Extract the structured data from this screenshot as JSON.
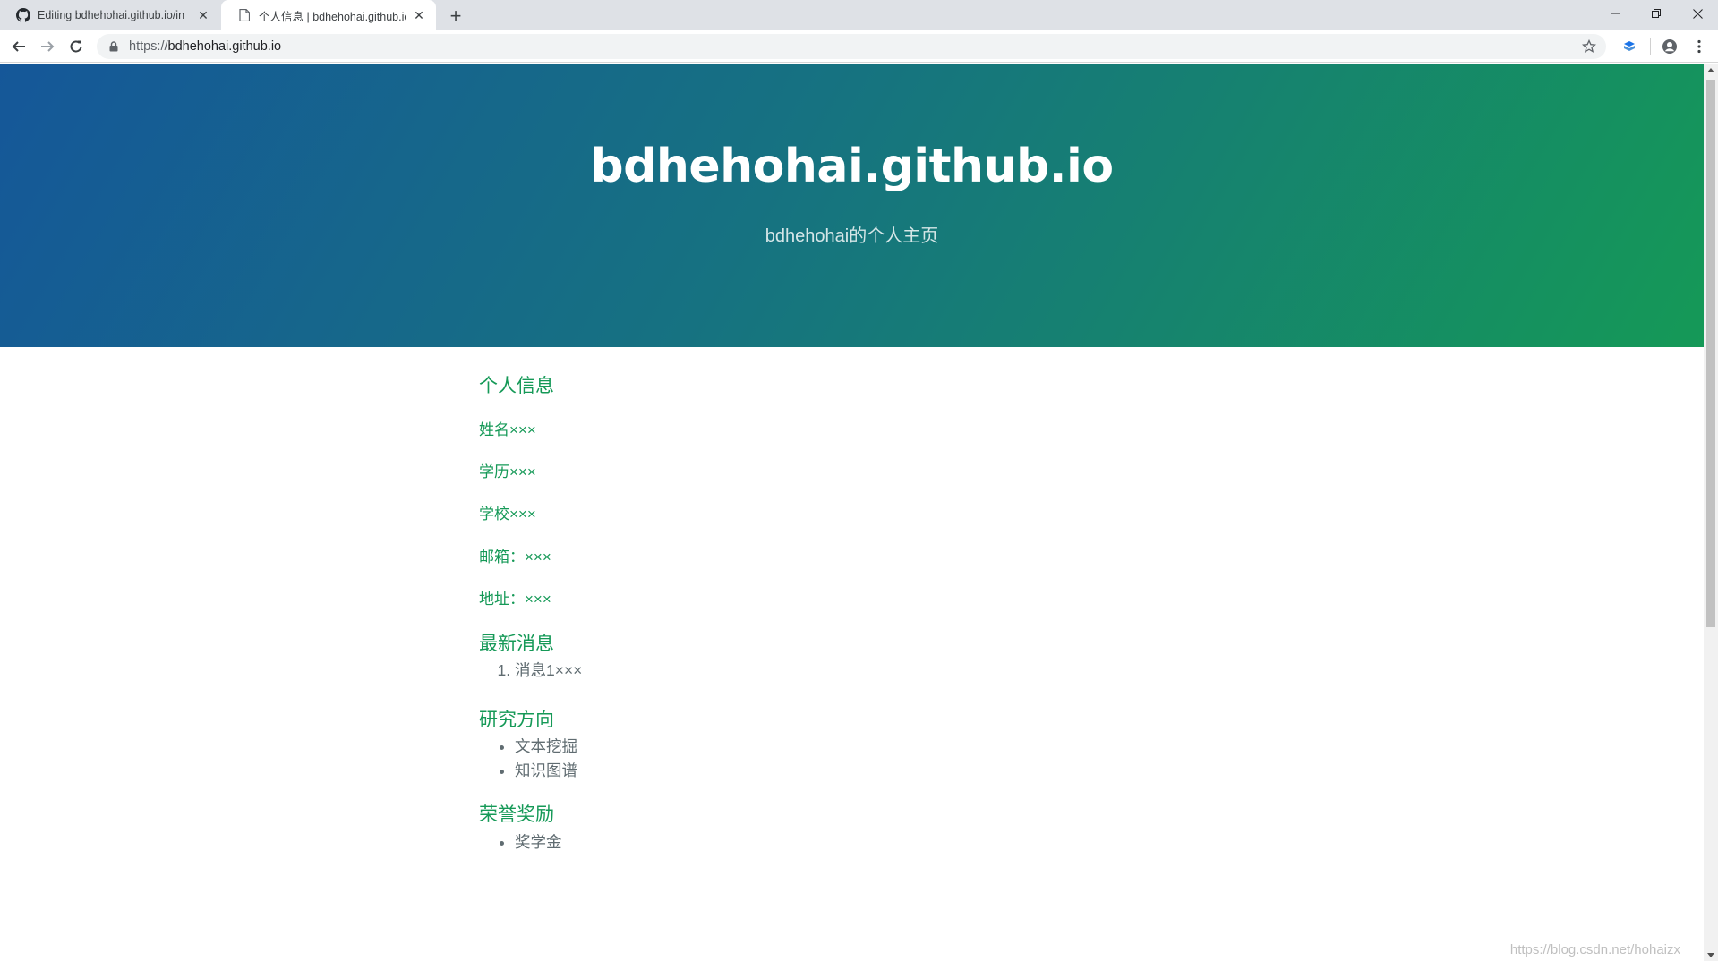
{
  "browser": {
    "tabs": [
      {
        "title": "Editing bdhehohai.github.io/in",
        "icon": "github-icon",
        "active": false
      },
      {
        "title": "个人信息 | bdhehohai.github.io",
        "icon": "page-icon",
        "active": true
      }
    ],
    "url": "https://bdhehohai.github.io",
    "url_host": "bdhehohai.github.io",
    "url_scheme": "https://"
  },
  "header": {
    "title": "bdhehohai.github.io",
    "tagline": "bdhehohai的个人主页"
  },
  "content": {
    "personal_info": {
      "heading": "个人信息",
      "items": [
        "姓名×××",
        "学历×××",
        "学校×××",
        "邮箱：×××",
        "地址：×××"
      ]
    },
    "news": {
      "heading": "最新消息",
      "items": [
        "消息1×××"
      ]
    },
    "research": {
      "heading": "研究方向",
      "items": [
        "文本挖掘",
        "知识图谱"
      ]
    },
    "honors": {
      "heading": "荣誉奖励",
      "items": [
        "奖学金"
      ]
    }
  },
  "watermark": "https://blog.csdn.net/hohaizx",
  "colors": {
    "gradient_start": "#155799",
    "gradient_end": "#159957",
    "section_heading": "#159957",
    "body_text": "#606c71"
  }
}
